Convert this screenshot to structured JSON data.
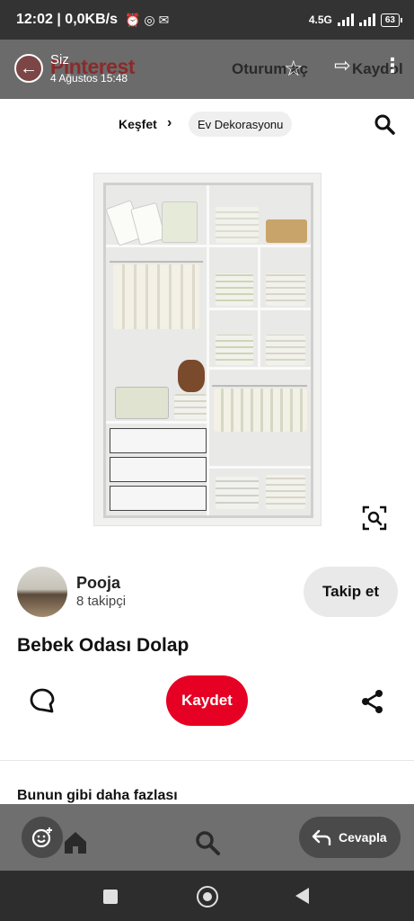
{
  "status_bar": {
    "time_speed": "12:02 | 0,0KB/s",
    "network": "4.5G",
    "battery": "63"
  },
  "header": {
    "brand": "Pinterest",
    "login_label": "Oturum aç",
    "signup_label": "Kaydol"
  },
  "notification": {
    "sender": "Siz",
    "timestamp": "4 Ağustos 15:48"
  },
  "breadcrumb": {
    "root": "Keşfet",
    "current": "Ev Dekorasyonu"
  },
  "author": {
    "name": "Pooja",
    "followers": "8 takipçi",
    "follow_label": "Takip et"
  },
  "pin": {
    "title": "Bebek Odası Dolap",
    "save_label": "Kaydet"
  },
  "more_like_this": "Bunun gibi daha fazlası",
  "reply": {
    "label": "Cevapla"
  },
  "colors": {
    "accent": "#e60023",
    "status_bar": "#333333",
    "overlay": "#6b6b6b"
  }
}
